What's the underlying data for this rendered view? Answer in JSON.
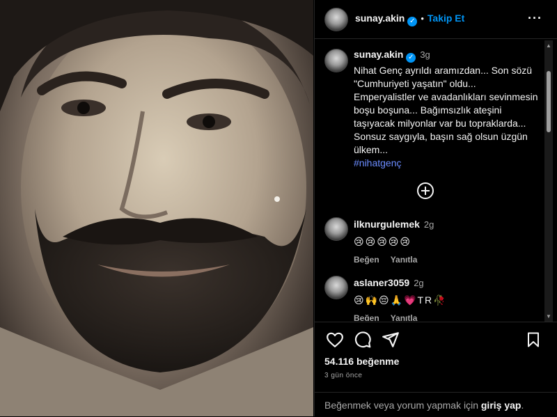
{
  "post": {
    "username": "sunay.akin",
    "verified": true,
    "follow_label": "Takip Et",
    "more_icon": "more-horizontal-icon"
  },
  "caption": {
    "username": "sunay.akin",
    "time": "3g",
    "text": "Nihat Genç ayrıldı aramızdan... Son sözü \"Cumhuriyeti yaşatın\" oldu... Emperyalistler ve avadanlıkları sevinmesin boşu boşuna... Bağımsızlık ateşini taşıyacak milyonlar var bu topraklarda... Sonsuz saygıyla, başın sağ olsun üzgün ülkem...",
    "hashtag": "#nihatgenç"
  },
  "comments": [
    {
      "username": "ilknurgulemek",
      "time": "2g",
      "emojis": "😢😢😢😢😢",
      "like_label": "Beğen",
      "reply_label": "Yanıtla"
    },
    {
      "username": "aslaner3059",
      "time": "2g",
      "emojis": "😢🙌😔🙏💗TR🥀",
      "like_label": "Beğen",
      "reply_label": "Yanıtla"
    }
  ],
  "stats": {
    "likes": "54.116 beğenme",
    "date": "3 gün önce"
  },
  "login": {
    "prefix": "Beğenmek veya yorum yapmak için ",
    "link": "giriş yap",
    "suffix": "."
  },
  "colors": {
    "accent": "#0095f6",
    "hashtag": "#6b8cff",
    "muted": "#a8a8a8",
    "background": "#000000"
  }
}
